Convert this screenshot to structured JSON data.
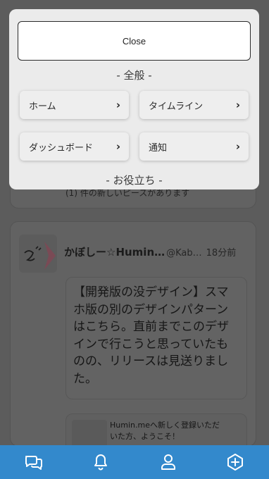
{
  "background": {
    "notice_text": "(1) 件の新しいピースがあります",
    "post": {
      "author_name": "かぼしー☆Humin…",
      "author_handle": "@Kab…",
      "time": "18分前",
      "body": "【開発版の没デザイン】スマホ版の別のデザインパターンはこちら。直前までこのデザインで行こうと思っていたものの、リリースは見送りました。",
      "quote_text": "Humin.meへ新しく登録いただいた方、ようこそ！"
    }
  },
  "menu": {
    "close_label": "Close",
    "section_general": "- 全般 -",
    "section_useful": "- お役立ち -",
    "items": [
      {
        "label": "ホーム",
        "chevron": "›"
      },
      {
        "label": "タイムライン",
        "chevron": "›"
      },
      {
        "label": "ダッシュボード",
        "chevron": "›"
      },
      {
        "label": "通知",
        "chevron": "›"
      }
    ]
  },
  "bottom_nav": {
    "color": "#3389cc",
    "icons": [
      "chat-bubbles-icon",
      "bell-icon",
      "user-icon",
      "add-piece-icon"
    ]
  }
}
